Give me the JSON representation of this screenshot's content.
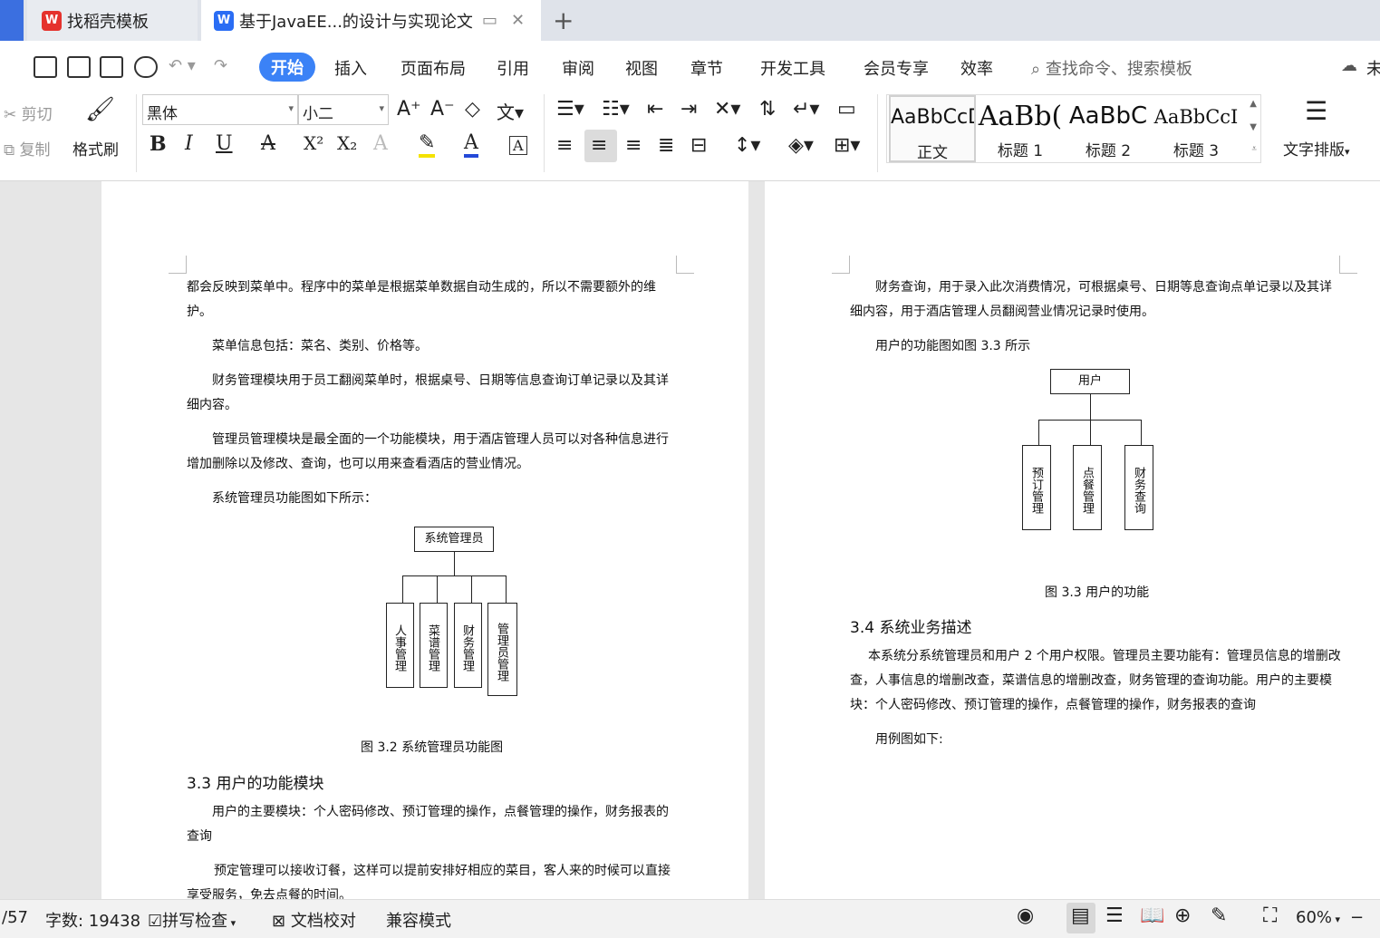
{
  "tabs": {
    "tab1_label": "找稻壳模板",
    "tab2_label": "基于JavaEE...的设计与实现论文"
  },
  "menu": {
    "items": [
      "开始",
      "插入",
      "页面布局",
      "引用",
      "审阅",
      "视图",
      "章节",
      "开发工具",
      "会员专享",
      "效率"
    ],
    "search_placeholder": "查找命令、搜索模板",
    "right_cut": "未"
  },
  "toolbar": {
    "cut": "剪切",
    "copy": "复制",
    "format_painter": "格式刷",
    "font_name": "黑体",
    "font_size": "小二",
    "text_layout": "文字排版",
    "styles": [
      {
        "sample": "AaBbCcD",
        "label": "正文"
      },
      {
        "sample": "AaBb(",
        "label": "标题 1"
      },
      {
        "sample": "AaBbC",
        "label": "标题 2"
      },
      {
        "sample": "AaBbCcI",
        "label": "标题 3"
      }
    ]
  },
  "page1": {
    "p1": "都会反映到菜单中。程序中的菜单是根据菜单数据自动生成的，所以不需要额外的维护。",
    "p2": "菜单信息包括：菜名、类别、价格等。",
    "p3": "财务管理模块用于员工翻阅菜单时，根据桌号、日期等信息查询订单记录以及其详细内容。",
    "p4": "管理员管理模块是最全面的一个功能模块，用于酒店管理人员可以对各种信息进行增加删除以及修改、查询，也可以用来查看酒店的营业情况。",
    "p5": "系统管理员功能图如下所示：",
    "diagram_root": "系统管理员",
    "diagram_children": [
      "人事管理",
      "菜谱管理",
      "财务管理",
      "管理员管理"
    ],
    "caption": "图 3.2 系统管理员功能图",
    "heading": "3.3  用户的功能模块",
    "p6": "用户的主要模块：个人密码修改、预订管理的操作，点餐管理的操作，财务报表的查询",
    "p7": "预定管理可以接收订餐，这样可以提前安排好相应的菜目，客人来的时候可以直接享受服务，免去点餐的时间。"
  },
  "page2": {
    "p1": "财务查询，用于录入此次消费情况，可根据桌号、日期等息查询点单记录以及其详细内容，用于酒店管理人员翻阅营业情况记录时使用。",
    "p2": "用户的功能图如图 3.3 所示",
    "diagram_root": "用户",
    "diagram_children": [
      "预订管理",
      "点餐管理",
      "财务查询"
    ],
    "caption": "图 3.3 用户的功能",
    "heading": "3.4  系统业务描述",
    "p3": "本系统分系统管理员和用户 2 个用户权限。管理员主要功能有：管理员信息的增删改查，人事信息的增删改查，菜谱信息的增删改查，财务管理的查询功能。用户的主要模块：个人密码修改、预订管理的操作，点餐管理的操作，财务报表的查询",
    "p4": "用例图如下:"
  },
  "status": {
    "page": "/57",
    "word_count": "字数: 19438",
    "spell_check": "拼写检查",
    "doc_check": "文档校对",
    "compat_mode": "兼容模式",
    "zoom": "60%"
  }
}
